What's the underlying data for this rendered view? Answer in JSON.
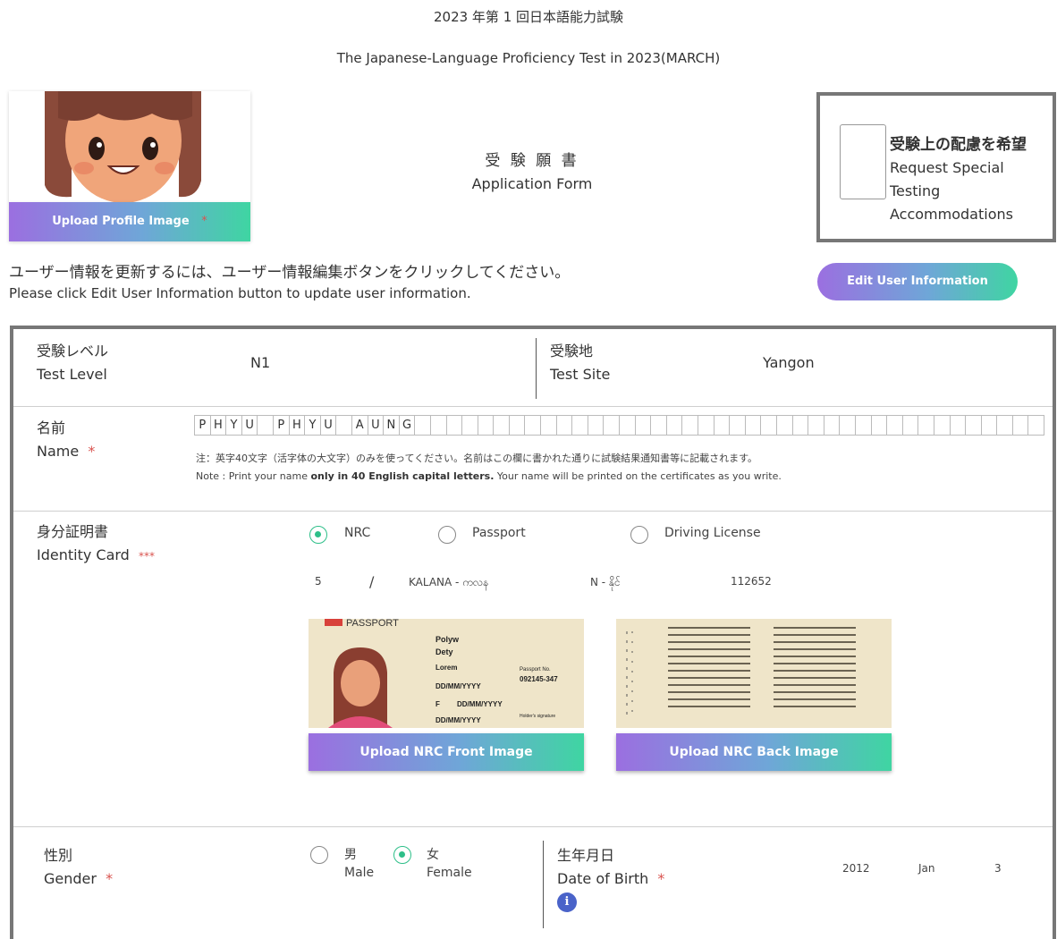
{
  "header": {
    "title_jp": "2023 年第 1 回日本語能力試験",
    "title_en": "The Japanese-Language Proficiency Test in 2023(MARCH)"
  },
  "profile": {
    "upload_label": "Upload Profile Image",
    "required_mark": "*"
  },
  "form_title": {
    "jp": "受 験 願 書",
    "en": "Application Form"
  },
  "special": {
    "jp": "受験上の配慮を希望",
    "en_line1": "Request Special",
    "en_line2": "Testing",
    "en_line3": "Accommodations"
  },
  "instructions": {
    "jp": "ユーザー情報を更新するには、ユーザー情報編集ボタンをクリックしてください。",
    "en": "Please click Edit User Information button to update user information."
  },
  "edit_button": "Edit User Information",
  "test_level": {
    "label_jp": "受験レベル",
    "label_en": "Test Level",
    "value": "N1"
  },
  "test_site": {
    "label_jp": "受験地",
    "label_en": "Test Site",
    "value": "Yangon"
  },
  "name": {
    "label_jp": "名前",
    "label_en": "Name",
    "required_mark": "*",
    "value": "PHYU PHYU AUNG",
    "max_length": 40,
    "note_jp": "注：英字40文字（活字体の大文字）のみを使ってください。名前はこの欄に書かれた通りに試験結果通知書等に記載されます。",
    "note_en_prefix": "Note : Print your name ",
    "note_en_bold": "only in 40 English capital letters.",
    "note_en_suffix": " Your name will be printed on the certificates as you write."
  },
  "identity": {
    "label_jp": "身分証明書",
    "label_en": "Identity Card",
    "required_mark": "***",
    "options": [
      "NRC",
      "Passport",
      "Driving License"
    ],
    "selected": "NRC",
    "nrc": {
      "state": "5",
      "slash": "/",
      "township": "KALANA - ကလန",
      "type": "N - နိုင်",
      "number": "112652"
    },
    "front_button": "Upload NRC Front Image",
    "back_button": "Upload NRC Back Image",
    "card_front": {
      "header": "PASSPORT",
      "surname": "Polyw",
      "given": "Dety",
      "nationality": "Lorem",
      "dob": "DD/MM/YYYY",
      "sex": "F",
      "date": "DD/MM/YYYY",
      "expiry": "DD/MM/YYYY",
      "passport_no": "092145-347",
      "passport_no_label": "Passport No.",
      "signature_label": "Holder's signature"
    }
  },
  "gender": {
    "label_jp": "性別",
    "label_en": "Gender",
    "required_mark": "*",
    "options": [
      {
        "jp": "男",
        "en": "Male"
      },
      {
        "jp": "女",
        "en": "Female"
      }
    ],
    "selected": "Female"
  },
  "dob": {
    "label_jp": "生年月日",
    "label_en": "Date of Birth",
    "required_mark": "*",
    "year": "2012",
    "month": "Jan",
    "day": "3",
    "info_icon": "info-icon"
  },
  "colors": {
    "accent_green": "#2ebf89",
    "gradient_start": "#9b6fe0",
    "gradient_end": "#3fd5a2",
    "required_red": "#d9534f",
    "info_blue": "#4a63c9"
  }
}
